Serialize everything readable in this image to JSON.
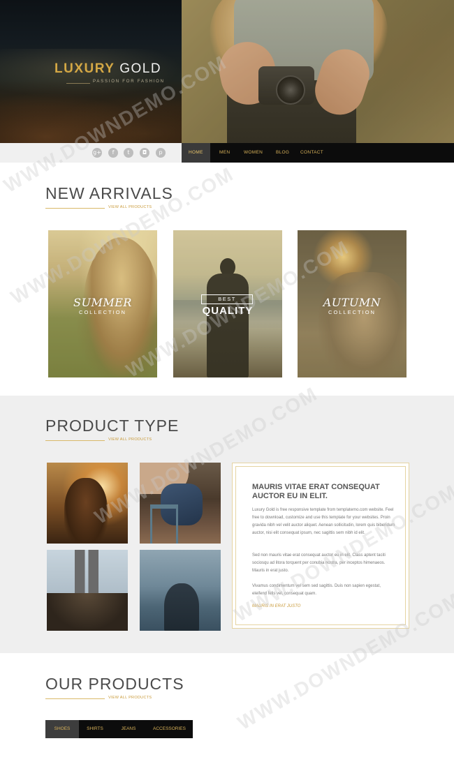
{
  "brand": {
    "name_gold": "LUXURY",
    "name_rest": "GOLD",
    "tagline": "PASSION FOR FASHION"
  },
  "social": {
    "icons": [
      {
        "name": "google-plus-icon",
        "glyph": "g+"
      },
      {
        "name": "facebook-icon",
        "glyph": "f"
      },
      {
        "name": "twitter-icon",
        "glyph": "t"
      },
      {
        "name": "instagram-icon",
        "glyph": "◘"
      },
      {
        "name": "pinterest-icon",
        "glyph": "p"
      }
    ]
  },
  "nav": {
    "items": [
      "HOME",
      "MEN",
      "WOMEN",
      "BLOG",
      "CONTACT"
    ],
    "active": "HOME"
  },
  "new_arrivals": {
    "title": "NEW ARRIVALS",
    "link": "VIEW ALL PRODUCTS",
    "cards": [
      {
        "script": "SUMMER",
        "sub": "COLLECTION"
      },
      {
        "boxed": "BEST",
        "main": "QUALITY"
      },
      {
        "script": "AUTUMN",
        "sub": "COLLECTION"
      }
    ]
  },
  "product_type": {
    "title": "PRODUCT TYPE",
    "link": "VIEW ALL PRODUCTS",
    "info": {
      "heading": "MAURIS VITAE ERAT CONSEQUAT AUCTOR EU IN ELIT.",
      "para1": "Luxury Gold is free responsive template from templatemo.com website. Feel free to download, customize and use this template for your websites. Proin gravida nibh vel velit auctor aliquet. Aenean sollicitudin, lorem quis bibendum auctor, nisi elit consequat ipsum, nec sagittis sem nibh id elit.",
      "para2": "Sed non mauris vitae erat consequat auctor eu in elit. Class aptent taciti sociosqu ad litora torquent per conubia nostra, per inceptos himenaeos. Mauris in erat justo.",
      "para3": "Vivamus condimentum vel sem sed sagittis. Duis non sapien egestat, eleifend felis vel, consequat quam.",
      "link": "MAURIS IN ERAT JUSTO"
    }
  },
  "our_products": {
    "title": "OUR PRODUCTS",
    "link": "VIEW ALL PRODUCTS",
    "tabs": [
      "SHOES",
      "SHIRTS",
      "JEANS",
      "ACCESSORIES"
    ],
    "active": "SHOES"
  },
  "watermark": "WWW.DOWNDEMO.COM",
  "colors": {
    "gold": "#d4a845",
    "link_gold": "#c99b3b",
    "nav_bg": "#0c0c0c",
    "section_bg": "#efefef"
  }
}
